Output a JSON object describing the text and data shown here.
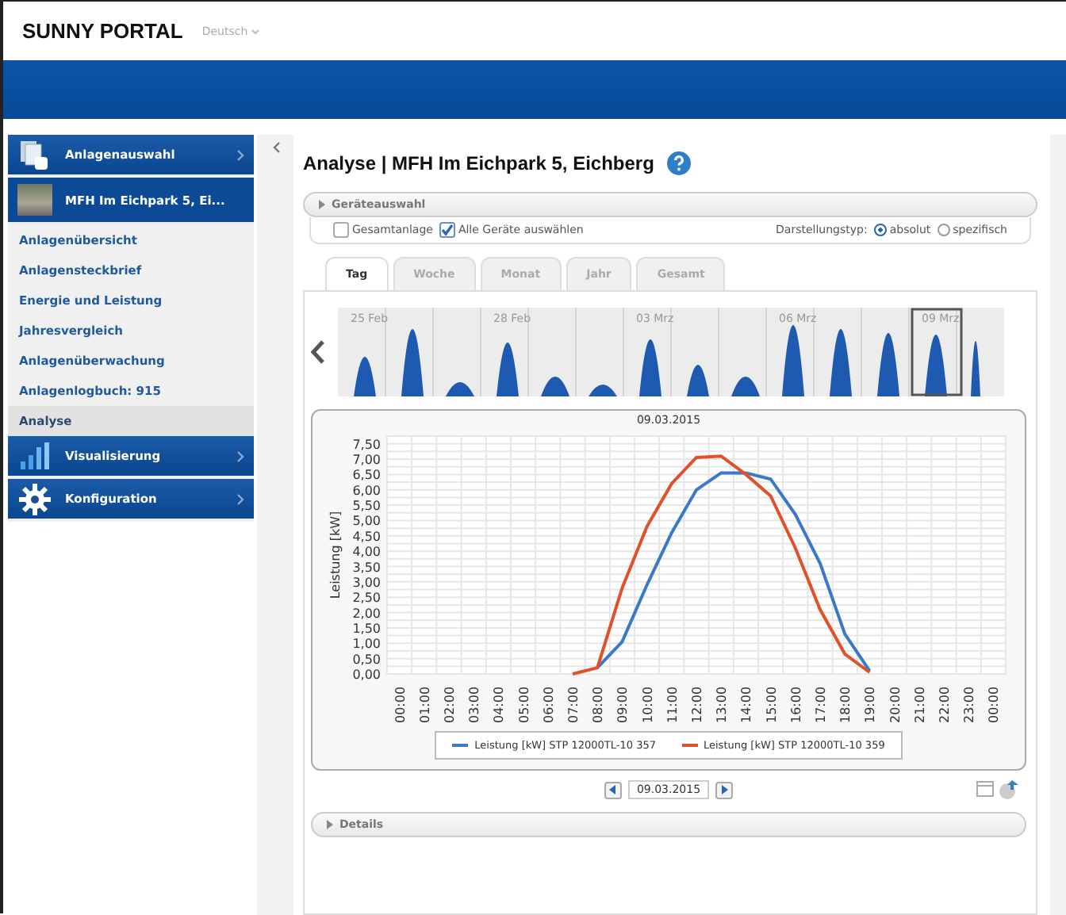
{
  "header": {
    "logo": "SUNNY PORTAL",
    "language": "Deutsch"
  },
  "sidebar": {
    "items": [
      {
        "kind": "header",
        "label": "Anlagenauswahl"
      },
      {
        "kind": "plant",
        "label": "MFH Im Eichpark 5, Ei..."
      },
      {
        "kind": "link",
        "label": "Anlagenübersicht",
        "selected": false
      },
      {
        "kind": "link",
        "label": "Anlagensteckbrief",
        "selected": false
      },
      {
        "kind": "link",
        "label": "Energie und Leistung",
        "selected": false
      },
      {
        "kind": "link",
        "label": "Jahresvergleich",
        "selected": false
      },
      {
        "kind": "link",
        "label": "Anlagenüberwachung",
        "selected": false
      },
      {
        "kind": "link",
        "label": "Anlagenlogbuch: 915",
        "selected": false
      },
      {
        "kind": "link",
        "label": "Analyse",
        "selected": true
      },
      {
        "kind": "header",
        "label": "Visualisierung"
      },
      {
        "kind": "header",
        "label": "Konfiguration"
      }
    ]
  },
  "page": {
    "title": "Analyse | MFH Im Eichpark 5, Eichberg"
  },
  "device_selection": {
    "title": "Geräteauswahl",
    "checkboxes": [
      {
        "label": "Gesamtanlage",
        "checked": false
      },
      {
        "label": "Alle Geräte auswählen",
        "checked": true
      }
    ],
    "display_type_label": "Darstellungstyp:",
    "radios": [
      {
        "label": "absolut",
        "selected": true
      },
      {
        "label": "spezifisch",
        "selected": false
      }
    ]
  },
  "tabs": [
    {
      "label": "Tag",
      "selected": true
    },
    {
      "label": "Woche",
      "selected": false
    },
    {
      "label": "Monat",
      "selected": false
    },
    {
      "label": "Jahr",
      "selected": false
    },
    {
      "label": "Gesamt",
      "selected": false
    }
  ],
  "overview": {
    "labels": [
      {
        "label": "25 Feb",
        "selected": false
      },
      {
        "label": "28 Feb",
        "selected": false
      },
      {
        "label": "03 Mrz",
        "selected": false
      },
      {
        "label": "06 Mrz",
        "selected": false
      },
      {
        "label": "09 Mrz",
        "selected": true
      }
    ]
  },
  "chart": {
    "chart_data": {
      "type": "line",
      "grid": true,
      "title": "09.03.2015",
      "ylabel": "Leistung [kW]",
      "categories": [
        "00:00",
        "01:00",
        "02:00",
        "03:00",
        "04:00",
        "05:00",
        "06:00",
        "07:00",
        "08:00",
        "09:00",
        "10:00",
        "11:00",
        "12:00",
        "13:00",
        "14:00",
        "15:00",
        "16:00",
        "17:00",
        "18:00",
        "19:00",
        "20:00",
        "21:00",
        "22:00",
        "23:00",
        "00:00"
      ],
      "ylim": [
        0,
        7.75
      ],
      "yticks": [
        {
          "value": 0,
          "label": "0,00"
        },
        {
          "value": 0.5,
          "label": "0,50"
        },
        {
          "value": 1,
          "label": "1,00"
        },
        {
          "value": 1.5,
          "label": "1,50"
        },
        {
          "value": 2,
          "label": "2,00"
        },
        {
          "value": 2.5,
          "label": "2,50"
        },
        {
          "value": 3,
          "label": "3,00"
        },
        {
          "value": 3.5,
          "label": "3,50"
        },
        {
          "value": 4,
          "label": "4,00"
        },
        {
          "value": 4.5,
          "label": "4,50"
        },
        {
          "value": 5,
          "label": "5,00"
        },
        {
          "value": 5.5,
          "label": "5,50"
        },
        {
          "value": 6,
          "label": "6,00"
        },
        {
          "value": 6.5,
          "label": "6,50"
        },
        {
          "value": 7,
          "label": "7,00"
        },
        {
          "value": 7.5,
          "label": "7,50"
        }
      ],
      "series": [
        {
          "name": "Leistung [kW] STP 12000TL-10 357",
          "color": "#3a78c8",
          "values": [
            null,
            null,
            null,
            null,
            null,
            null,
            null,
            null,
            0.2,
            1.05,
            2.9,
            4.6,
            6.0,
            6.55,
            6.55,
            6.35,
            5.2,
            3.6,
            1.3,
            0.1,
            null,
            null,
            null,
            null,
            null
          ]
        },
        {
          "name": "Leistung [kW] STP 12000TL-10 359",
          "color": "#e0502a",
          "values": [
            null,
            null,
            null,
            null,
            null,
            null,
            null,
            0.0,
            0.2,
            2.8,
            4.8,
            6.2,
            7.05,
            7.1,
            6.5,
            5.8,
            4.1,
            2.1,
            0.65,
            0.05,
            null,
            null,
            null,
            null,
            null
          ]
        }
      ]
    }
  },
  "date_nav": {
    "date": "09.03.2015"
  },
  "details": {
    "title": "Details"
  }
}
